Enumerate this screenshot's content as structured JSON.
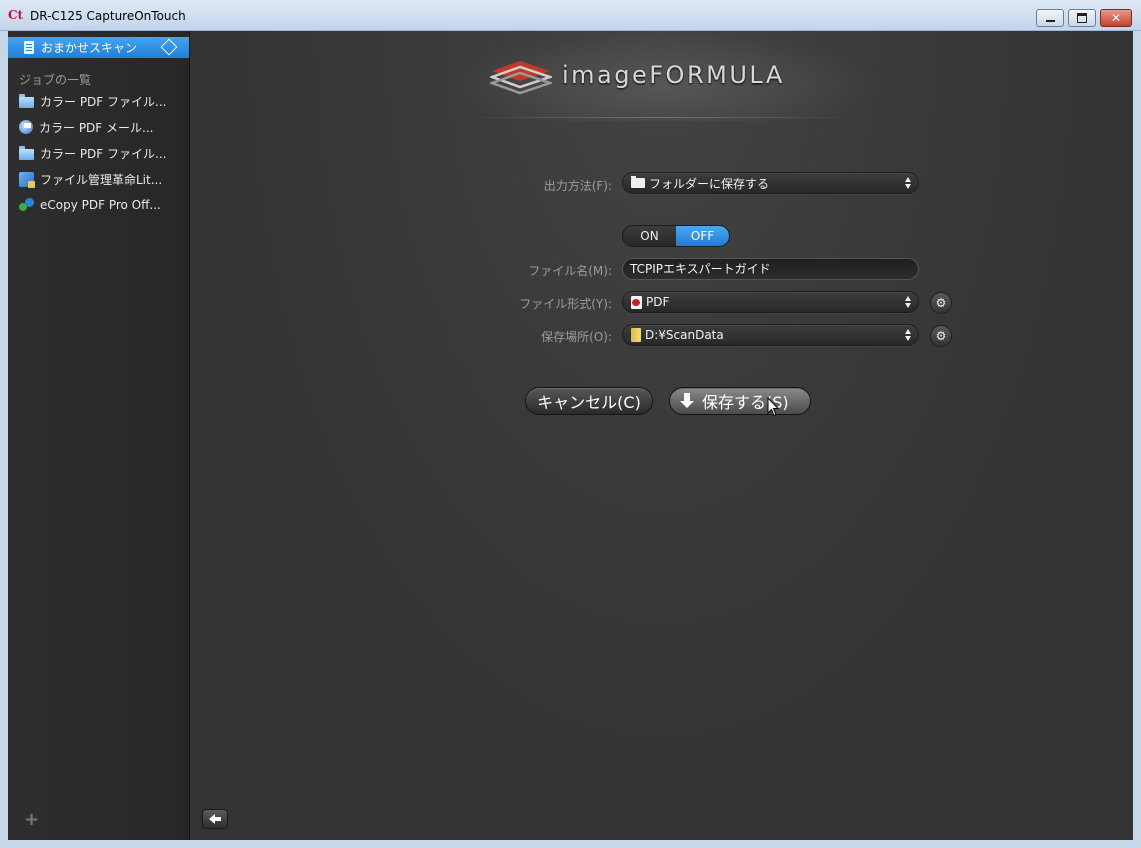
{
  "window": {
    "title": "DR-C125 CaptureOnTouch",
    "icon_label": "Ct"
  },
  "sidebar": {
    "auto_scan_label": "おまかせスキャン",
    "jobs_heading": "ジョブの一覧",
    "jobs": [
      {
        "label": "カラー PDF ファイル...",
        "icon": "folder-icon"
      },
      {
        "label": "カラー PDF メール...",
        "icon": "mail-icon"
      },
      {
        "label": "カラー PDF ファイル...",
        "icon": "folder-icon"
      },
      {
        "label": "ファイル管理革命Lit...",
        "icon": "app-icon"
      },
      {
        "label": "eCopy PDF Pro Off...",
        "icon": "ecopy-icon"
      }
    ],
    "add_label": "+"
  },
  "main": {
    "logo_text": "imageFORMULA",
    "output_method": {
      "label": "出力方法(F):",
      "value": "フォルダーに保存する"
    },
    "toggle": {
      "on_label": "ON",
      "off_label": "OFF",
      "selected": "OFF"
    },
    "file_name": {
      "label": "ファイル名(M):",
      "value": "TCPIPエキスパートガイド"
    },
    "file_format": {
      "label": "ファイル形式(Y):",
      "value": "PDF"
    },
    "save_location": {
      "label": "保存場所(O):",
      "value": "D:¥ScanData"
    },
    "cancel_label": "キャンセル(C)",
    "save_label": "保存する(S)"
  },
  "colors": {
    "accent": "#2a8ae0",
    "background": "#3a3a3a",
    "sidebar": "#2b2b2b"
  }
}
